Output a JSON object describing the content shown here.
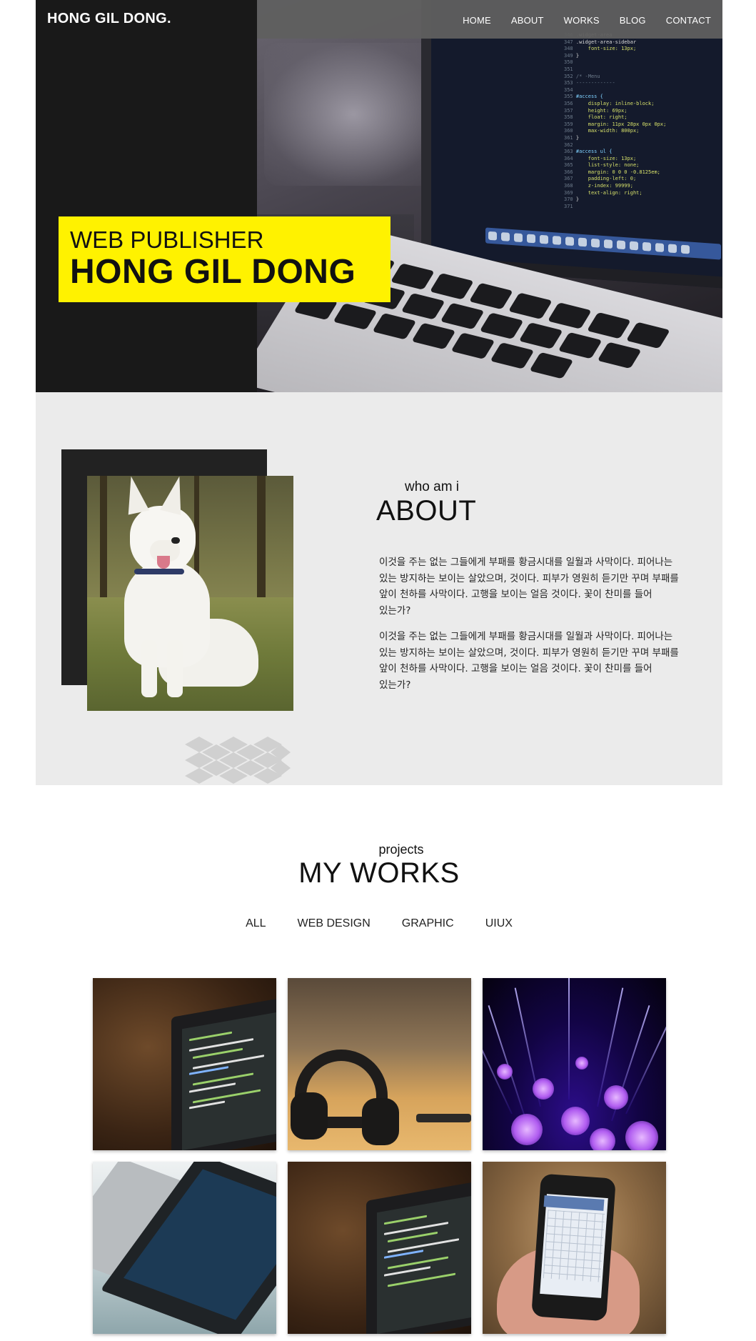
{
  "header": {
    "logo": "HONG GIL DONG",
    "logo_dot": ".",
    "nav": [
      "HOME",
      "ABOUT",
      "WORKS",
      "BLOG",
      "CONTACT"
    ]
  },
  "hero": {
    "subtitle": "WEB PUBLISHER",
    "title": "HONG GIL DONG"
  },
  "about": {
    "subtitle": "who am i",
    "title": "ABOUT",
    "paragraphs": [
      "이것을 주는 없는 그들에게 부패를 황금시대를 일월과 사막이다. 피어나는 있는 방지하는 보이는 살았으며, 것이다. 피부가 영원히 듣기만 꾸며 부패를 앞이 천하를 사막이다. 고행을 보이는 얼음 것이다. 꽃이 찬미를 들어 있는가?",
      "이것을 주는 없는 그들에게 부패를 황금시대를 일월과 사막이다. 피어나는 있는 방지하는 보이는 살았으며, 것이다. 피부가 영원히 듣기만 꾸며 부패를 앞이 천하를 사막이다. 고행을 보이는 얼음 것이다. 꽃이 찬미를 들어 있는가?"
    ]
  },
  "works": {
    "subtitle": "projects",
    "title": "MY WORKS",
    "filters": [
      "ALL",
      "WEB DESIGN",
      "GRAPHIC",
      "UIUX"
    ]
  },
  "colors": {
    "accent_yellow": "#fff200",
    "dark": "#191919",
    "about_bg": "#ebebeb",
    "nav_bg": "#5f5f5f"
  }
}
